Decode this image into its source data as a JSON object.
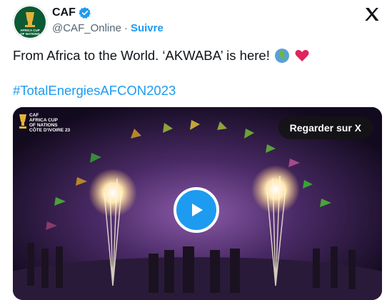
{
  "account": {
    "name": "CAF",
    "handle": "@CAF_Online",
    "separator": "·",
    "follow_label": "Suivre",
    "avatar_text": "AFRICA CUP OF NATIONS"
  },
  "tweet": {
    "text": "From Africa to the World. ‘AKWABA’ is here!",
    "emojis": [
      "globe-africa-icon",
      "red-heart-icon"
    ],
    "hashtag": "#TotalEnergiesAFCON2023"
  },
  "video": {
    "watch_label": "Regarder sur X",
    "logo_lines": [
      "CAF",
      "AFRICA CUP",
      "OF NATIONS",
      "CÔTE D'IVOIRE 23"
    ]
  },
  "colors": {
    "link": "#1d9bf0",
    "verified": "#1d9bf0",
    "text": "#0f1419",
    "muted": "#536471",
    "heart": "#e0245e"
  }
}
